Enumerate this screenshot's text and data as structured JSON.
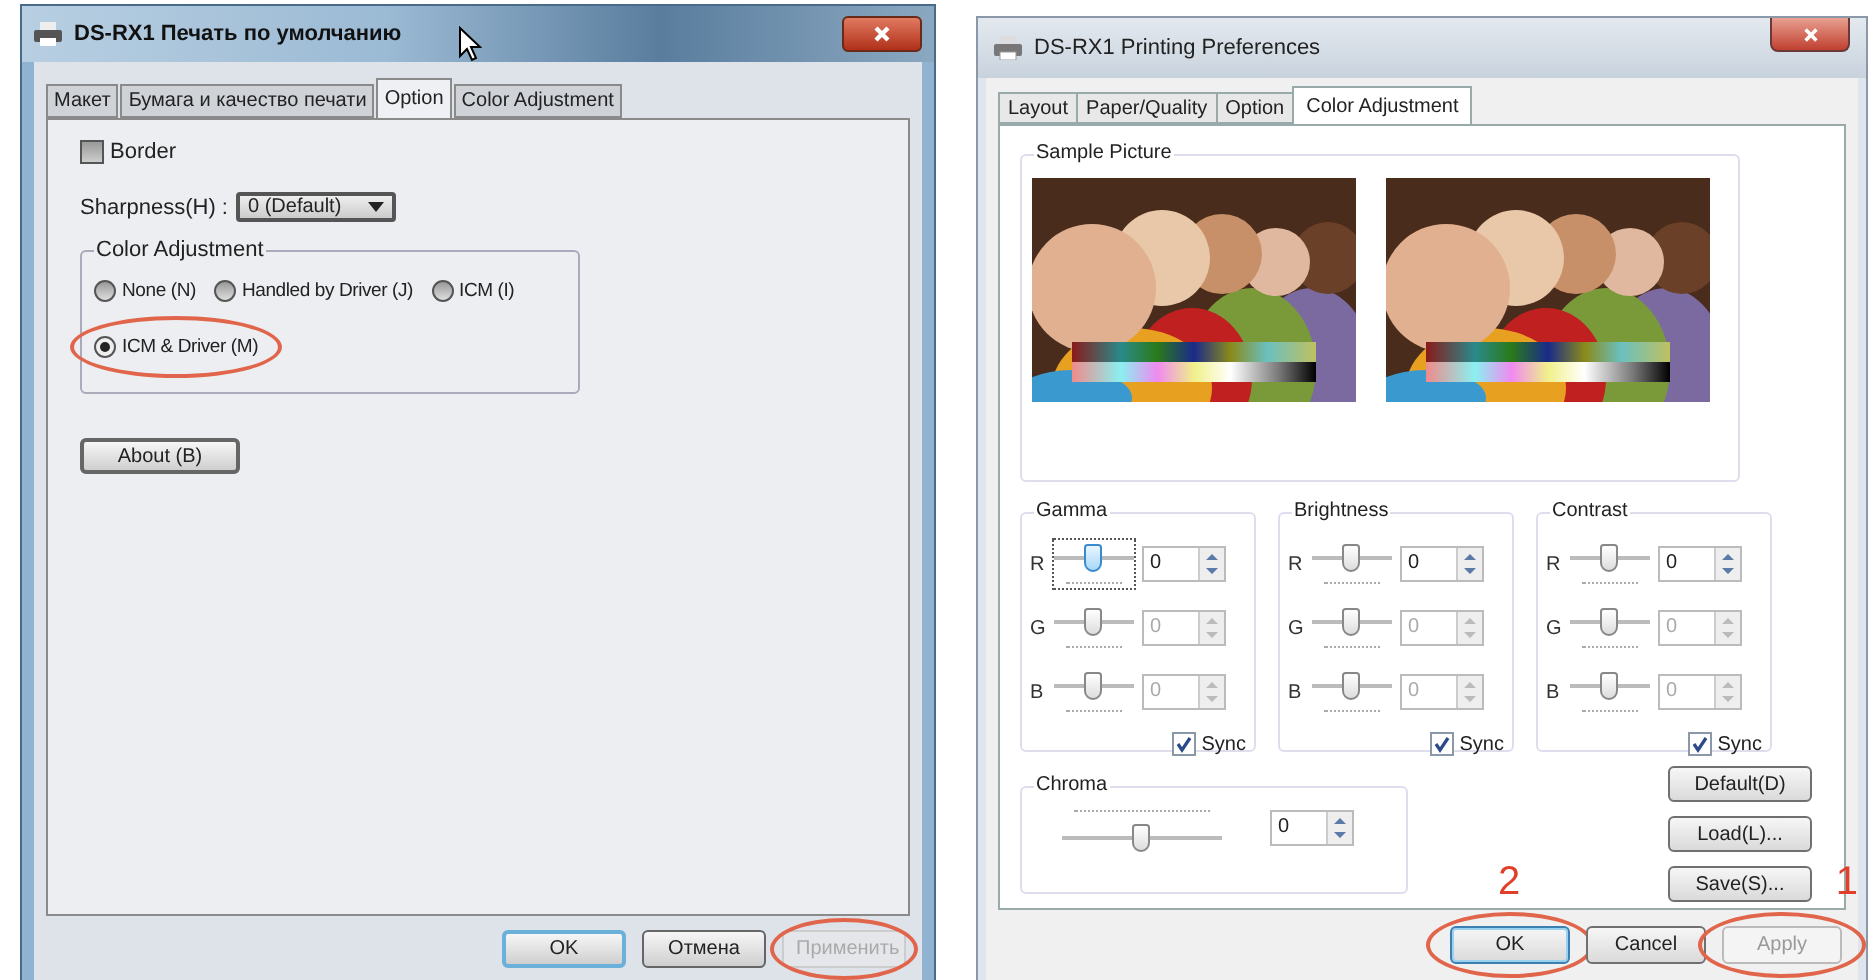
{
  "left_window": {
    "title": "DS-RX1 Печать по умолчанию",
    "tabs": [
      {
        "label": "Макет",
        "selected": false
      },
      {
        "label": "Бумага и качество печати",
        "selected": false
      },
      {
        "label": "Option",
        "selected": true
      },
      {
        "label": "Color Adjustment",
        "selected": false
      }
    ],
    "border_checkbox": {
      "label": "Border",
      "checked": false
    },
    "sharpness": {
      "label": "Sharpness(H) :",
      "value": "0 (Default)"
    },
    "color_adjustment": {
      "title": "Color Adjustment",
      "options": [
        {
          "label": "None (N)",
          "selected": false,
          "circled": false
        },
        {
          "label": "Handled by Driver (J)",
          "selected": false,
          "circled": false
        },
        {
          "label": "ICM (I)",
          "selected": false,
          "circled": false
        },
        {
          "label": "ICM  & Driver (M)",
          "selected": true,
          "circled": true
        }
      ]
    },
    "about_button": "About (B)",
    "buttons": [
      {
        "label": "OK",
        "default": true,
        "disabled": false,
        "circled": false
      },
      {
        "label": "Отмена",
        "default": false,
        "disabled": false,
        "circled": false
      },
      {
        "label": "Применить",
        "default": false,
        "disabled": true,
        "circled": true
      }
    ]
  },
  "right_window": {
    "title": "DS-RX1 Printing Preferences",
    "tabs": [
      {
        "label": "Layout",
        "selected": false
      },
      {
        "label": "Paper/Quality",
        "selected": false
      },
      {
        "label": "Option",
        "selected": false
      },
      {
        "label": "Color Adjustment",
        "selected": true
      }
    ],
    "sample_picture": {
      "title": "Sample Picture"
    },
    "groups": [
      {
        "title": "Gamma",
        "channels": [
          {
            "label": "R",
            "level": 0.5,
            "value": "0",
            "disabled": false,
            "focused": true
          },
          {
            "label": "G",
            "level": 0.5,
            "value": "0",
            "disabled": true,
            "focused": false
          },
          {
            "label": "B",
            "level": 0.5,
            "value": "0",
            "disabled": true,
            "focused": false
          }
        ],
        "sync": {
          "label": "Sync",
          "checked": true
        }
      },
      {
        "title": "Brightness",
        "channels": [
          {
            "label": "R",
            "level": 0.5,
            "value": "0",
            "disabled": false,
            "focused": false
          },
          {
            "label": "G",
            "level": 0.5,
            "value": "0",
            "disabled": true,
            "focused": false
          },
          {
            "label": "B",
            "level": 0.5,
            "value": "0",
            "disabled": true,
            "focused": false
          }
        ],
        "sync": {
          "label": "Sync",
          "checked": true
        }
      },
      {
        "title": "Contrast",
        "channels": [
          {
            "label": "R",
            "level": 0.5,
            "value": "0",
            "disabled": false,
            "focused": false
          },
          {
            "label": "G",
            "level": 0.5,
            "value": "0",
            "disabled": true,
            "focused": false
          },
          {
            "label": "B",
            "level": 0.5,
            "value": "0",
            "disabled": true,
            "focused": false
          }
        ],
        "sync": {
          "label": "Sync",
          "checked": true
        }
      }
    ],
    "chroma": {
      "title": "Chroma",
      "level": 0.5,
      "value": "0"
    },
    "side_buttons": [
      "Default(D)",
      "Load(L)...",
      "Save(S)..."
    ],
    "buttons": [
      {
        "label": "OK",
        "default": true,
        "disabled": false,
        "circled": true,
        "callout": "2"
      },
      {
        "label": "Cancel",
        "default": false,
        "disabled": false,
        "circled": false
      },
      {
        "label": "Apply",
        "default": false,
        "disabled": true,
        "circled": true,
        "callout": "1"
      }
    ]
  }
}
